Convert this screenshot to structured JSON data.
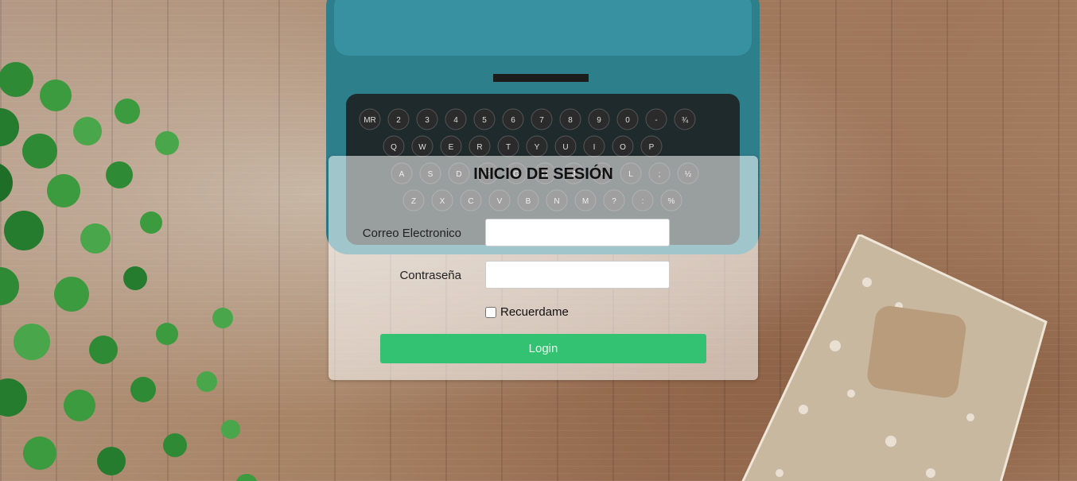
{
  "login": {
    "title": "INICIO DE SESIÓN",
    "email_label": "Correo Electronico",
    "email_value": "",
    "password_label": "Contraseña",
    "password_value": "",
    "remember_label": "Recuerdame",
    "remember_checked": false,
    "login_button": "Login",
    "button_color": "#33c271"
  },
  "background": {
    "keyboard_rows": [
      [
        "MR",
        "2",
        "3",
        "4",
        "5",
        "6",
        "7",
        "8",
        "9",
        "0",
        "-",
        "¾"
      ],
      [
        "Q",
        "W",
        "E",
        "R",
        "T",
        "Y",
        "U",
        "I",
        "O",
        "P"
      ],
      [
        "A",
        "S",
        "D",
        "F",
        "G",
        "H",
        "J",
        "K",
        "L",
        ";",
        "½"
      ],
      [
        "Z",
        "X",
        "C",
        "V",
        "B",
        "N",
        "M",
        "?",
        ":",
        "%"
      ]
    ]
  }
}
